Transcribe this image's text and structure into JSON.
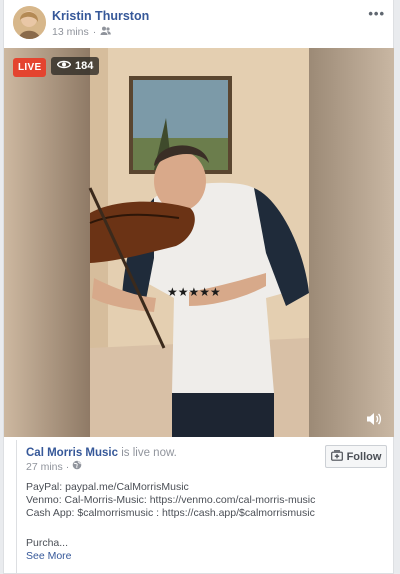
{
  "post": {
    "author": "Kristin Thurston",
    "time": "13 mins",
    "audience_icon": "friends-icon",
    "more_label": "•••"
  },
  "video": {
    "live_label": "LIVE",
    "viewer_count": "184",
    "volume_icon": "volume-icon"
  },
  "shared": {
    "page_name": "Cal Morris Music",
    "status": "is live now.",
    "time": "27 mins",
    "audience_icon": "globe-icon",
    "follow_label": "Follow",
    "paypal": "PayPal: paypal.me/CalMorrisMusic",
    "venmo": "Venmo: Cal-Morris-Music: https://venmo.com/cal-morris-music",
    "cashapp": "Cash App: $calmorrismusic : https://cash.app/$calmorrismusic",
    "truncated": "Purcha...",
    "see_more": "See More"
  },
  "colors": {
    "live": "#e4442f",
    "link": "#365899",
    "meta": "#90949c"
  }
}
